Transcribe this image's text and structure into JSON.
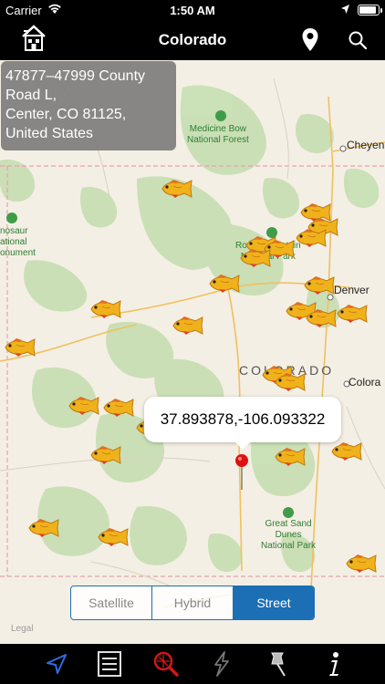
{
  "status_bar": {
    "carrier": "Carrier",
    "time": "1:50 AM",
    "battery_level": 0.9
  },
  "nav": {
    "title": "Colorado",
    "left_icon": "home-icon",
    "right_icons": [
      "location-pin-icon",
      "search-icon"
    ]
  },
  "address": {
    "text": "47877–47999 County\nRoad L,\nCenter, CO  81125,\nUnited States"
  },
  "coordinates": {
    "text": "37.893878,-106.093322"
  },
  "map_labels": {
    "medicine_bow": "Medicine Bow\nNational Forest",
    "cheyenne": "Cheyenn",
    "dinosaur": "nosaur\national\nonument",
    "rocky_mountain": "Rocky Mountain\nNational Park",
    "denver": "Denver",
    "colorado_state": "COLORADO",
    "colorado_springs": "Colora",
    "great_sand_dunes": "Great Sand\nDunes\nNational Park",
    "legal": "Legal"
  },
  "map_type": {
    "options": [
      "Satellite",
      "Hybrid",
      "Street"
    ],
    "selected": "Street"
  },
  "tab_bar": {
    "icons": [
      "navigate-arrow-icon",
      "list-icon",
      "search-map-icon",
      "lightning-icon",
      "pushpin-icon",
      "info-icon"
    ]
  },
  "colors": {
    "nav_bg": "#000000",
    "accent": "#1c6fb4",
    "map_bg": "#f4efe4",
    "forest": "#c8dfb4",
    "pin": "#e01010"
  }
}
